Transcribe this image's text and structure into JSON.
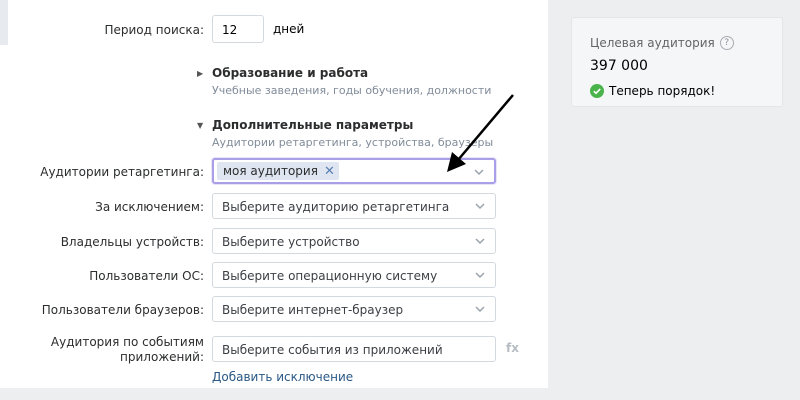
{
  "search_period": {
    "label": "Период поиска:",
    "value": "12",
    "unit": "дней"
  },
  "sections": {
    "education": {
      "title": "Образование и работа",
      "subtitle": "Учебные заведения, годы обучения, должности"
    },
    "extra": {
      "title": "Дополнительные параметры",
      "subtitle": "Аудитории ретаргетинга, устройства, браузеры"
    }
  },
  "fields": {
    "retargeting": {
      "label": "Аудитории ретаргетинга:",
      "token": "моя аудитория"
    },
    "exclusion": {
      "label": "За исключением:",
      "placeholder": "Выберите аудиторию ретаргетинга"
    },
    "devices": {
      "label": "Владельцы устройств:",
      "placeholder": "Выберите устройство"
    },
    "os": {
      "label": "Пользователи ОС:",
      "placeholder": "Выберите операционную систему"
    },
    "browsers": {
      "label": "Пользователи браузеров:",
      "placeholder": "Выберите интернет-браузер"
    },
    "app_events": {
      "label_line1": "Аудитория по событиям",
      "label_line2": "приложений:",
      "placeholder": "Выберите события из приложений",
      "fx": "fx"
    }
  },
  "add_exclusion": "Добавить исключение",
  "audience_panel": {
    "title": "Целевая аудитория",
    "help": "?",
    "count": "397 000",
    "status": "Теперь порядок!"
  },
  "colors": {
    "link": "#2a5885",
    "active_border": "#a99fe7",
    "success": "#4bb34b",
    "token_bg": "#dfe6f2"
  }
}
